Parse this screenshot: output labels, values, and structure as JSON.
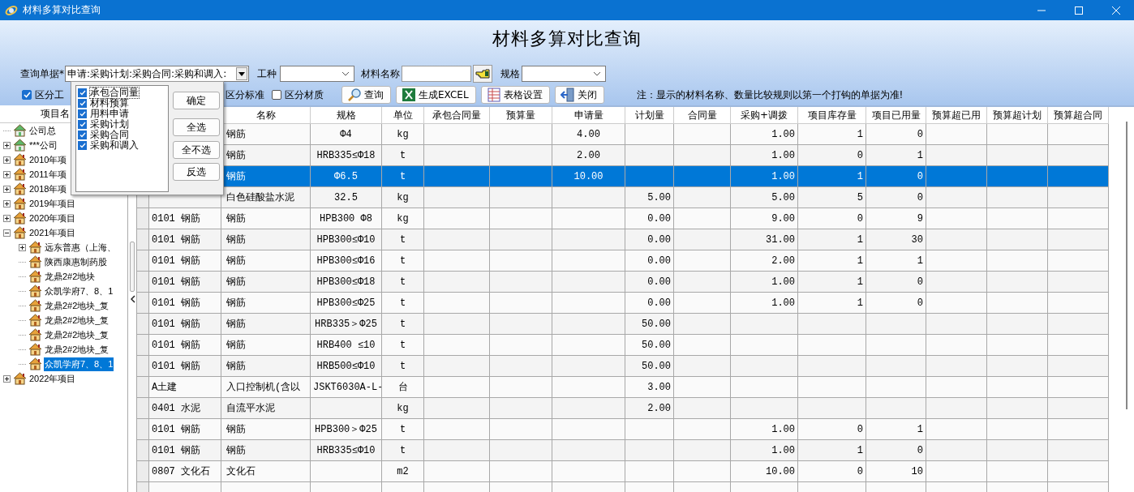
{
  "window": {
    "title": "材料多算对比查询"
  },
  "heading": "材料多算对比查询",
  "filters": {
    "doc_label": "查询单据*",
    "doc_value": "申请:采购计划:采购合同:采购和调入:",
    "trade_label": "工种",
    "material_label": "材料名称",
    "spec_label": "规格"
  },
  "options": [
    {
      "label": "区分工",
      "checked": true
    },
    {
      "label": "区分标准"
    },
    {
      "label": "区分材质",
      "checked": false
    }
  ],
  "toolbar": [
    {
      "label": "查询",
      "kind": "search"
    },
    {
      "label": "生成EXCEL",
      "kind": "excel"
    },
    {
      "label": "表格设置",
      "kind": "grid"
    },
    {
      "label": "关闭",
      "kind": "exit"
    }
  ],
  "note": "注：显示的材料名称、数量比较规则以第一个打钩的单据为准!",
  "doc_popup": {
    "items": [
      {
        "label": "承包合同量",
        "checked": true,
        "focused": true
      },
      {
        "label": "材料预算",
        "checked": true,
        "focused": false
      },
      {
        "label": "用料申请",
        "checked": true,
        "focused": false
      },
      {
        "label": "采购计划",
        "checked": true,
        "focused": false
      },
      {
        "label": "采购合同",
        "checked": true,
        "focused": false
      },
      {
        "label": "采购和调入",
        "checked": true,
        "focused": false
      }
    ],
    "buttons": [
      "确定",
      "全选",
      "全不选",
      "反选"
    ]
  },
  "tree": {
    "header": "项目名",
    "items": [
      {
        "label": "公司总",
        "kind": "company",
        "selected": false
      },
      {
        "label": "***公司",
        "kind": "company",
        "expanded": false,
        "selected": false
      },
      {
        "label": "2010年项",
        "kind": "project",
        "expanded": false,
        "selected": false
      },
      {
        "label": "2011年项",
        "kind": "project",
        "expanded": false,
        "selected": false
      },
      {
        "label": "2018年项",
        "kind": "project",
        "expanded": false,
        "selected": false
      },
      {
        "label": "2019年项目",
        "kind": "project",
        "expanded": false,
        "selected": false
      },
      {
        "label": "2020年项目",
        "kind": "project",
        "expanded": false,
        "selected": false
      },
      {
        "label": "2021年项目",
        "kind": "project",
        "expanded": true,
        "selected": false,
        "children": [
          {
            "label": "远东普惠（上海、",
            "kind": "project",
            "expanded": false,
            "selected": false
          },
          {
            "label": "陕西康惠制药股",
            "kind": "project",
            "selected": false
          },
          {
            "label": "龙鼎2#2地块",
            "kind": "project",
            "selected": false
          },
          {
            "label": "众凯学府7、8、1",
            "kind": "project",
            "selected": false
          },
          {
            "label": "龙鼎2#2地块_复",
            "kind": "project",
            "selected": false
          },
          {
            "label": "龙鼎2#2地块_复",
            "kind": "project",
            "selected": false
          },
          {
            "label": "龙鼎2#2地块_复",
            "kind": "project",
            "selected": false
          },
          {
            "label": "龙鼎2#2地块_复",
            "kind": "project",
            "selected": false
          },
          {
            "label": "众凯学府7、8、1",
            "kind": "project",
            "selected": true
          }
        ]
      },
      {
        "label": "2022年项目",
        "kind": "project",
        "expanded": false,
        "selected": false
      }
    ]
  },
  "table": {
    "columns": [
      null,
      "名称",
      "规格",
      "单位",
      "承包合同量",
      "预算量",
      "申请量",
      "计划量",
      "合同量",
      "采购+调拨",
      "项目库存量",
      "项目已用量",
      "预算超已用",
      "预算超计划",
      "预算超合同"
    ],
    "rows": [
      {
        "selected": false,
        "cells": [
          null,
          "钢筋",
          "Φ4",
          "kg",
          null,
          null,
          "4.00",
          null,
          null,
          "1.00",
          "1",
          "0",
          null,
          null,
          null
        ]
      },
      {
        "selected": false,
        "cells": [
          null,
          "钢筋",
          "HRB335≤Φ18",
          "t",
          null,
          null,
          "2.00",
          null,
          null,
          "1.00",
          "0",
          "1",
          null,
          null,
          null
        ]
      },
      {
        "selected": true,
        "cells": [
          null,
          "钢筋",
          "Φ6.5",
          "t",
          null,
          null,
          "10.00",
          null,
          null,
          "1.00",
          "1",
          "0",
          null,
          null,
          null
        ]
      },
      {
        "selected": false,
        "cells": [
          null,
          "白色硅酸盐水泥",
          "32.5",
          "kg",
          null,
          null,
          null,
          "5.00",
          null,
          "5.00",
          "5",
          "0",
          null,
          null,
          null
        ]
      },
      {
        "selected": false,
        "cells": [
          "0101 钢筋",
          "钢筋",
          "HPB300 Φ8",
          "kg",
          null,
          null,
          null,
          "0.00",
          null,
          "9.00",
          "0",
          "9",
          null,
          null,
          null
        ]
      },
      {
        "selected": false,
        "cells": [
          "0101 钢筋",
          "钢筋",
          "HPB300≤Φ10",
          "t",
          null,
          null,
          null,
          "0.00",
          null,
          "31.00",
          "1",
          "30",
          null,
          null,
          null
        ]
      },
      {
        "selected": false,
        "cells": [
          "0101 钢筋",
          "钢筋",
          "HPB300≤Φ16",
          "t",
          null,
          null,
          null,
          "0.00",
          null,
          "2.00",
          "1",
          "1",
          null,
          null,
          null
        ]
      },
      {
        "selected": false,
        "cells": [
          "0101 钢筋",
          "钢筋",
          "HPB300≤Φ18",
          "t",
          null,
          null,
          null,
          "0.00",
          null,
          "1.00",
          "1",
          "0",
          null,
          null,
          null
        ]
      },
      {
        "selected": false,
        "cells": [
          "0101 钢筋",
          "钢筋",
          "HPB300≤Φ25",
          "t",
          null,
          null,
          null,
          "0.00",
          null,
          "1.00",
          "1",
          "0",
          null,
          null,
          null
        ]
      },
      {
        "selected": false,
        "cells": [
          "0101 钢筋",
          "钢筋",
          "HRB335＞Φ25",
          "t",
          null,
          null,
          null,
          "50.00",
          null,
          null,
          null,
          null,
          null,
          null,
          null
        ]
      },
      {
        "selected": false,
        "cells": [
          "0101 钢筋",
          "钢筋",
          "HRB400 ≤10",
          "t",
          null,
          null,
          null,
          "50.00",
          null,
          null,
          null,
          null,
          null,
          null,
          null
        ]
      },
      {
        "selected": false,
        "cells": [
          "0101 钢筋",
          "钢筋",
          "HRB500≤Φ10",
          "t",
          null,
          null,
          null,
          "50.00",
          null,
          null,
          null,
          null,
          null,
          null,
          null
        ]
      },
      {
        "selected": false,
        "cells": [
          "A土建",
          "入口控制机(含以",
          "JSKT6030A-L-",
          "台",
          null,
          null,
          null,
          "3.00",
          null,
          null,
          null,
          null,
          null,
          null,
          null
        ]
      },
      {
        "selected": false,
        "cells": [
          "0401 水泥",
          "自流平水泥",
          null,
          "kg",
          null,
          null,
          null,
          "2.00",
          null,
          null,
          null,
          null,
          null,
          null,
          null
        ]
      },
      {
        "selected": false,
        "cells": [
          "0101 钢筋",
          "钢筋",
          "HPB300＞Φ25",
          "t",
          null,
          null,
          null,
          null,
          null,
          "1.00",
          "0",
          "1",
          null,
          null,
          null
        ]
      },
      {
        "selected": false,
        "cells": [
          "0101 钢筋",
          "钢筋",
          "HRB335≤Φ10",
          "t",
          null,
          null,
          null,
          null,
          null,
          "1.00",
          "1",
          "0",
          null,
          null,
          null
        ]
      },
      {
        "selected": false,
        "cells": [
          "0807 文化石",
          "文化石",
          null,
          "m2",
          null,
          null,
          null,
          null,
          null,
          "10.00",
          "0",
          "10",
          null,
          null,
          null
        ]
      }
    ]
  }
}
